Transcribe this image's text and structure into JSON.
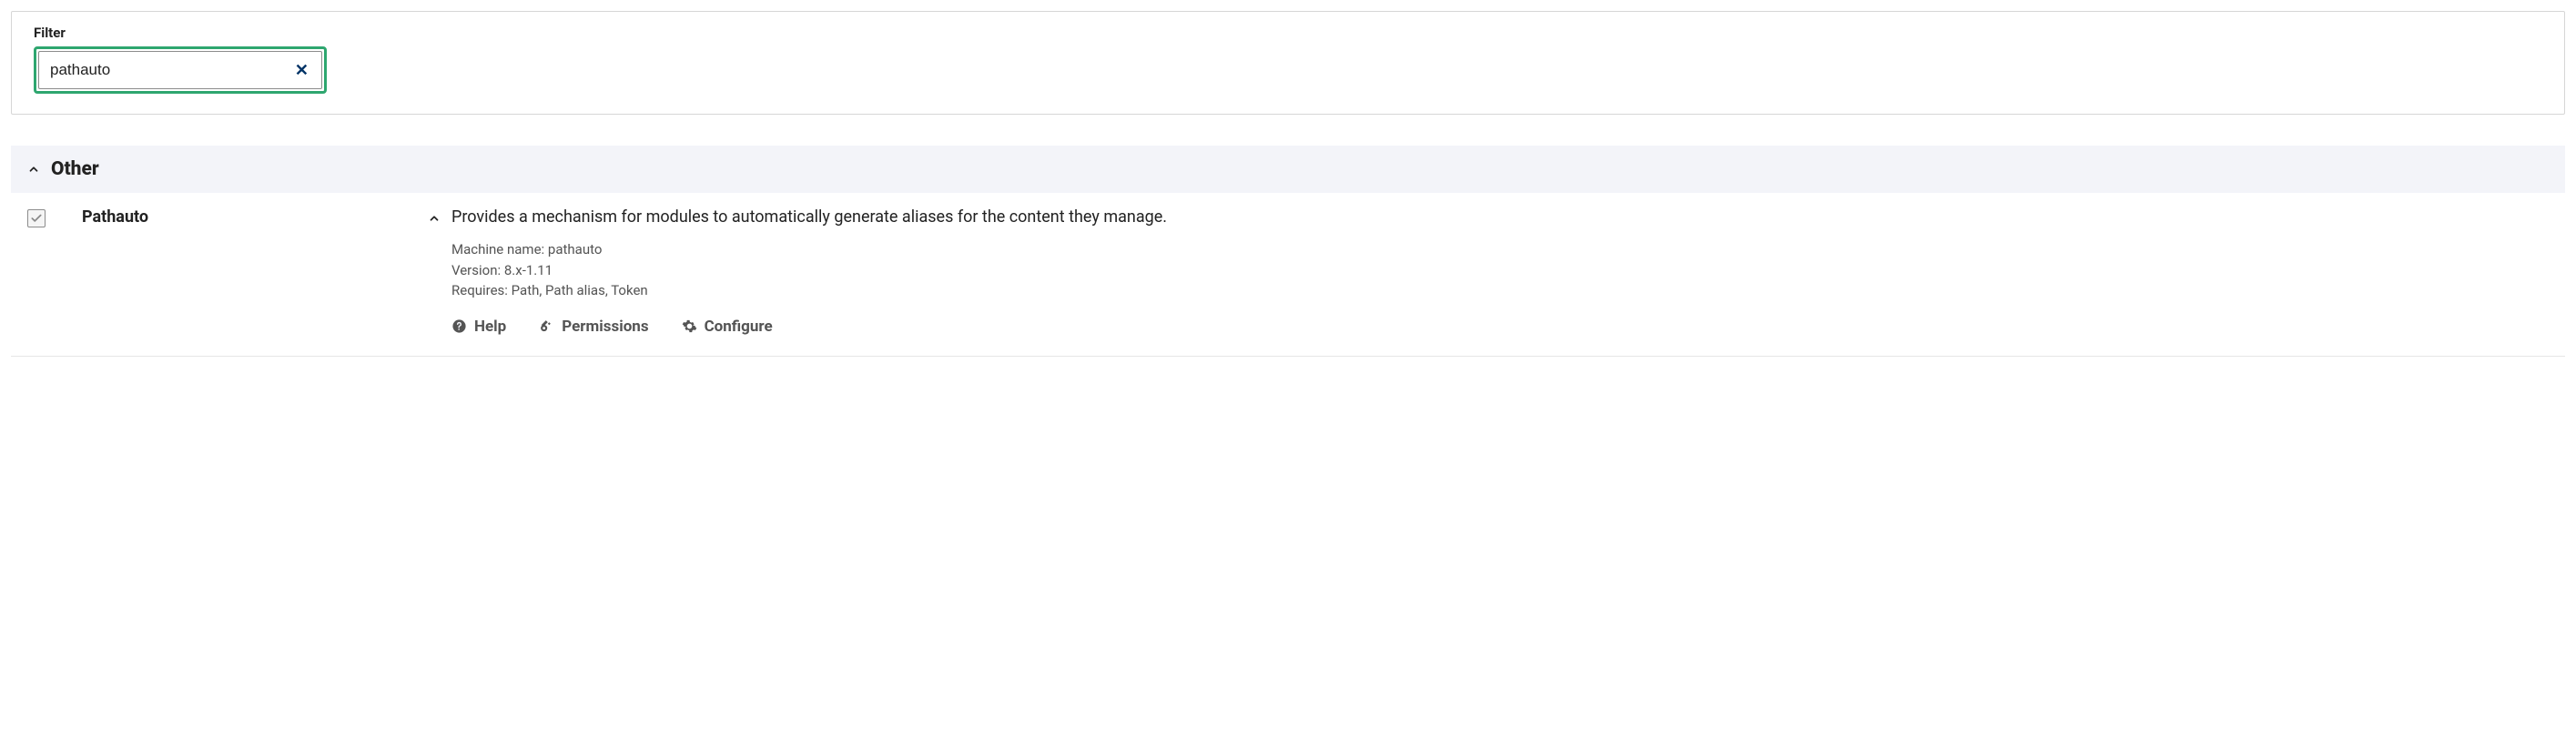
{
  "filter": {
    "label": "Filter",
    "value": "pathauto"
  },
  "group": {
    "title": "Other"
  },
  "module": {
    "name": "Pathauto",
    "description": "Provides a mechanism for modules to automatically generate aliases for the content they manage.",
    "machine_name_label": "Machine name:",
    "machine_name": "pathauto",
    "version_label": "Version:",
    "version": "8.x-1.11",
    "requires_label": "Requires:",
    "requires": "Path, Path alias, Token",
    "links": {
      "help": "Help",
      "permissions": "Permissions",
      "configure": "Configure"
    }
  }
}
